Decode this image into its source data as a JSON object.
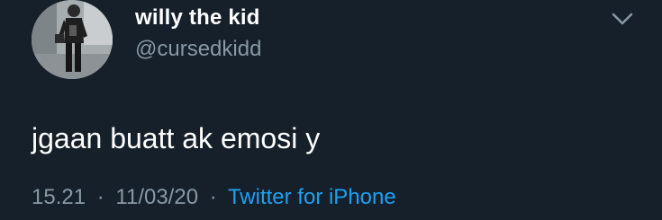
{
  "tweet": {
    "display_name": "willy the kid",
    "handle": "@cursedkidd",
    "text": "jgaan buatt ak emosi y",
    "time": "15.21",
    "date": "11/03/20",
    "separator": "·",
    "source": "Twitter for iPhone"
  },
  "icons": {
    "more": "chevron-down-icon",
    "avatar": "profile-photo"
  },
  "colors": {
    "background": "#15202b",
    "primary_text": "#ffffff",
    "secondary_text": "#8899a6",
    "link": "#1da1f2"
  }
}
